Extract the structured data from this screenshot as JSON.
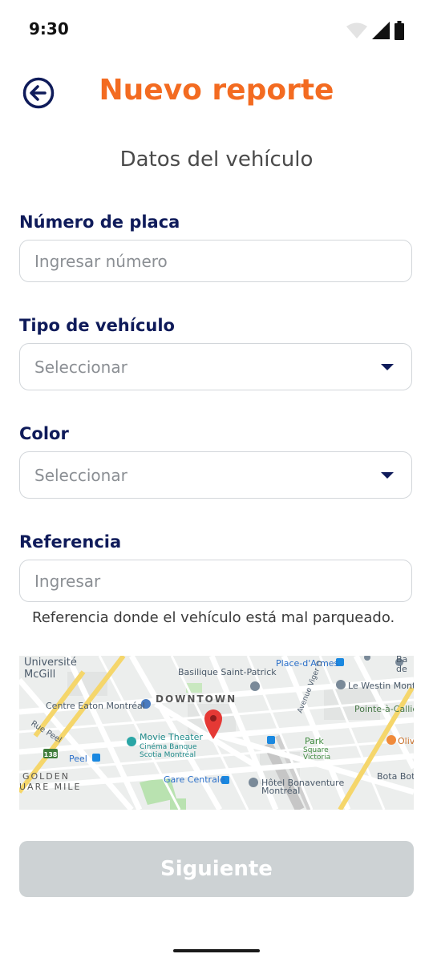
{
  "status_bar": {
    "time": "9:30",
    "icons": [
      "wifi-icon",
      "signal-icon",
      "battery-icon"
    ]
  },
  "header": {
    "title": "Nuevo reporte",
    "back_icon": "back-arrow-icon"
  },
  "section": {
    "title": "Datos del vehículo"
  },
  "form": {
    "plate": {
      "label": "Número de placa",
      "placeholder": "Ingresar número"
    },
    "vehicle_type": {
      "label": "Tipo de vehículo",
      "placeholder": "Seleccionar"
    },
    "color": {
      "label": "Color",
      "placeholder": "Seleccionar"
    },
    "reference": {
      "label": "Referencia",
      "placeholder": "Ingresar",
      "hint": "Referencia donde el vehículo está mal parqueado."
    }
  },
  "map": {
    "labels": {
      "mcgill_1": "Université",
      "mcgill_2": "McGill",
      "basilique": "Basilique Saint-Patrick",
      "place_armes": "Place-d'Armes",
      "downtown": "DOWNTOWN",
      "eaton": "Centre Eaton Montréal",
      "westin": "Le Westin Mont",
      "pointe": "Pointe-à-Callié",
      "rue_peel": "Rue Peel",
      "movie_1": "Movie Theater",
      "movie_2": "Cinéma Banque",
      "movie_3": "Scotia Montréal",
      "park_1": "Park",
      "park_2": "Square",
      "park_3": "Victoria",
      "olive": "Oliv",
      "peel_station": "Peel",
      "route": "138",
      "golden_1": "GOLDEN",
      "golden_2": "UARE MILE",
      "gare": "Gare Centrale",
      "bonaventure_1": "Hôtel Bonaventure",
      "bonaventure_2": "Montréal",
      "bota": "Bota Bota",
      "viger": "Avenue Viger O",
      "ba": "Ba",
      "de": "de"
    },
    "pin_color": "#e53935"
  },
  "actions": {
    "next": "Siguiente"
  },
  "colors": {
    "accent": "#f36b21",
    "navy": "#0f1b5a",
    "button_disabled": "#cdd2d4"
  }
}
